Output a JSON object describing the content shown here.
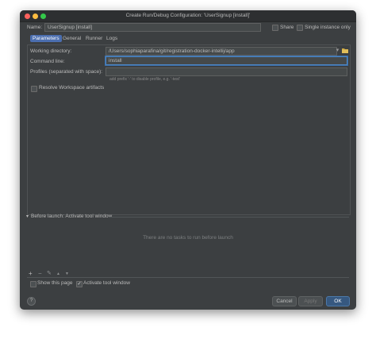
{
  "window": {
    "title": "Create Run/Debug Configuration: 'UserSignup [install]'"
  },
  "header": {
    "name_label": "Name:",
    "name_value": "UserSignup [install]",
    "share_label": "Share",
    "single_instance_label": "Single instance only"
  },
  "tabs": [
    "Parameters",
    "General",
    "Runner",
    "Logs"
  ],
  "form": {
    "working_dir_label": "Working directory:",
    "working_dir_value": "/Users/sophiaparafina/git/registration-docker-intellij/app",
    "command_line_label": "Command line:",
    "command_line_value": "install",
    "profiles_label": "Profiles (separated with space):",
    "profiles_value": "",
    "profiles_hint": "add prefix '-' to disable profile, e.g. '-test'",
    "resolve_label": "Resolve Workspace artifacts"
  },
  "before_launch": {
    "header": "Before launch: Activate tool window",
    "empty_text": "There are no tasks to run before launch"
  },
  "options": {
    "show_page_label": "Show this page",
    "activate_label": "Activate tool window"
  },
  "buttons": {
    "cancel": "Cancel",
    "apply": "Apply",
    "ok": "OK"
  },
  "icons": {
    "help": "?",
    "disclosure": "▾",
    "add": "+",
    "remove": "−",
    "edit": "✎",
    "up": "▲",
    "down": "▼",
    "check": "✓"
  },
  "colors": {
    "background": "#3c3f41",
    "accent": "#4b6eaf",
    "ok": "#365880"
  }
}
